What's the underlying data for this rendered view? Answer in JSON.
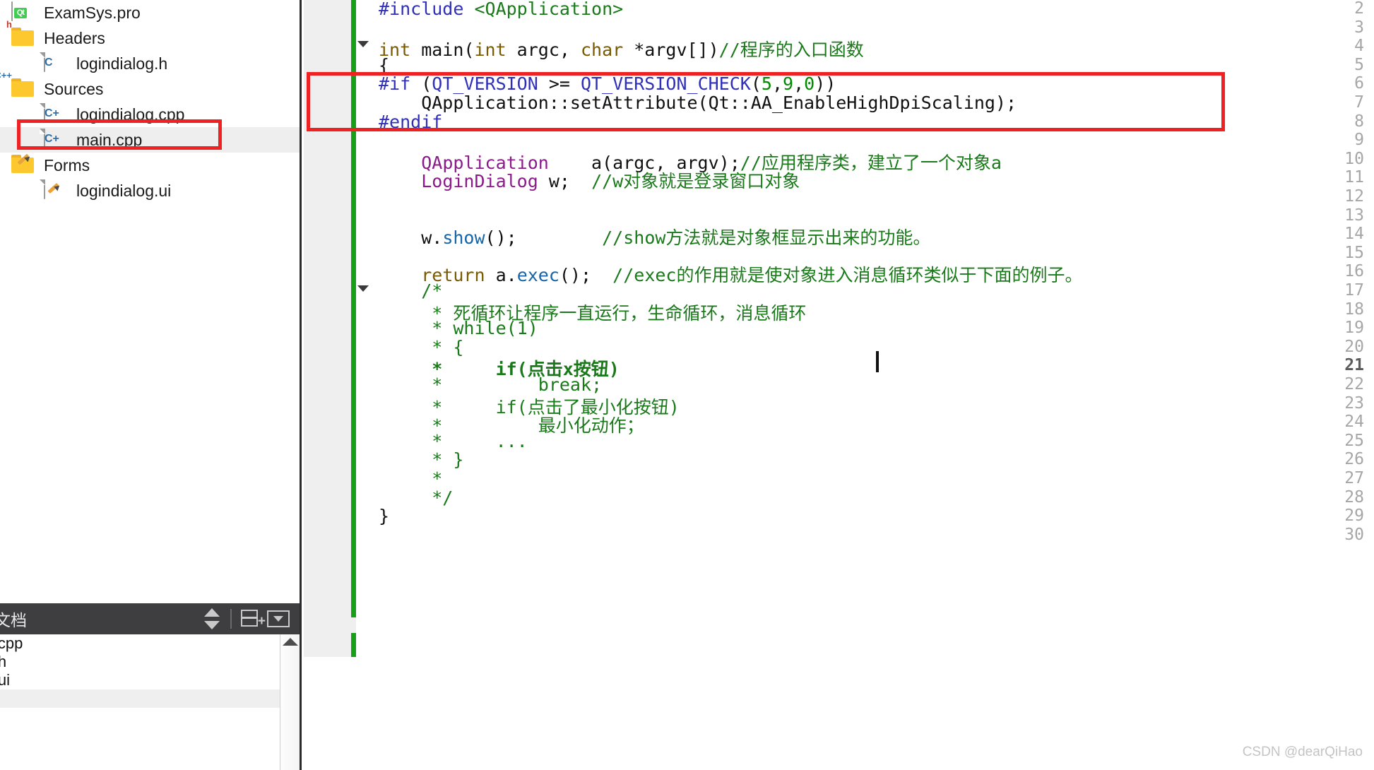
{
  "project_tree": {
    "items": [
      {
        "label": "ExamSys.pro",
        "icon": "qt-project-file-icon",
        "indent": 0,
        "selected": false,
        "kind": "qt"
      },
      {
        "label": "Headers",
        "icon": "folder-headers-icon",
        "indent": 0,
        "selected": false,
        "kind": "folder",
        "badge": "h",
        "badge_color": "#c0392b"
      },
      {
        "label": "logindialog.h",
        "icon": "c-header-file-icon",
        "indent": 1,
        "selected": false,
        "kind": "file",
        "badge": "C",
        "badge_color": "#2e6fa8"
      },
      {
        "label": "Sources",
        "icon": "folder-sources-icon",
        "indent": 0,
        "selected": false,
        "kind": "folder",
        "badge": "C++",
        "badge_color": "#2e6fa8"
      },
      {
        "label": "logindialog.cpp",
        "icon": "cpp-source-file-icon",
        "indent": 1,
        "selected": false,
        "kind": "file",
        "badge": "C+",
        "badge_color": "#2e6fa8"
      },
      {
        "label": "main.cpp",
        "icon": "cpp-source-file-icon",
        "indent": 1,
        "selected": true,
        "kind": "file",
        "badge": "C+",
        "badge_color": "#2e6fa8"
      },
      {
        "label": "Forms",
        "icon": "folder-forms-icon",
        "indent": 0,
        "selected": false,
        "kind": "folder",
        "badge": "",
        "badge_color": "#e8a33d"
      },
      {
        "label": "logindialog.ui",
        "icon": "ui-form-file-icon",
        "indent": 1,
        "selected": false,
        "kind": "ui",
        "badge": "",
        "badge_color": "#e8a33d"
      }
    ]
  },
  "documents_panel": {
    "title": "文档",
    "buttons": [
      {
        "name": "sort-updown-button",
        "label": ""
      },
      {
        "name": "split-add-button",
        "label": ""
      },
      {
        "name": "close-dropdown-button",
        "label": ""
      }
    ],
    "files": [
      {
        "label": "dialog.cpp",
        "selected": false
      },
      {
        "label": "dialog.h",
        "selected": false
      },
      {
        "label": "dialog.ui",
        "selected": false
      },
      {
        "label": "cpp",
        "selected": true
      }
    ]
  },
  "editor": {
    "first_line": 2,
    "last_line": 30,
    "current_line": 21,
    "fold_markers": [
      4,
      17
    ],
    "lines": [
      {
        "n": 2,
        "segments": [
          {
            "t": "#include ",
            "c": "pre"
          },
          {
            "t": "<QApplication>",
            "c": "cmt"
          }
        ]
      },
      {
        "n": 3,
        "segments": []
      },
      {
        "n": 4,
        "segments": [
          {
            "t": "int",
            "c": "kw"
          },
          {
            "t": " main(",
            "c": "plain"
          },
          {
            "t": "int",
            "c": "kw"
          },
          {
            "t": " argc, ",
            "c": "plain"
          },
          {
            "t": "char",
            "c": "kw"
          },
          {
            "t": " *argv[])",
            "c": "plain"
          },
          {
            "t": "//程序的入口函数",
            "c": "cmt"
          }
        ]
      },
      {
        "n": 5,
        "segments": [
          {
            "t": "{",
            "c": "plain"
          }
        ]
      },
      {
        "n": 6,
        "segments": [
          {
            "t": "#if",
            "c": "pre"
          },
          {
            "t": " (",
            "c": "plain"
          },
          {
            "t": "QT_VERSION",
            "c": "pre"
          },
          {
            "t": " >= ",
            "c": "plain"
          },
          {
            "t": "QT_VERSION_CHECK",
            "c": "pre"
          },
          {
            "t": "(",
            "c": "plain"
          },
          {
            "t": "5",
            "c": "num"
          },
          {
            "t": ",",
            "c": "plain"
          },
          {
            "t": "9",
            "c": "num"
          },
          {
            "t": ",",
            "c": "plain"
          },
          {
            "t": "0",
            "c": "num"
          },
          {
            "t": "))",
            "c": "plain"
          }
        ]
      },
      {
        "n": 7,
        "segments": [
          {
            "t": "    QApplication::setAttribute(Qt::AA_EnableHighDpiScaling);",
            "c": "plain"
          }
        ]
      },
      {
        "n": 8,
        "segments": [
          {
            "t": "#endif",
            "c": "pre"
          }
        ]
      },
      {
        "n": 9,
        "segments": []
      },
      {
        "n": 10,
        "segments": [
          {
            "t": "    ",
            "c": "plain"
          },
          {
            "t": "QApplication",
            "c": "type"
          },
          {
            "t": "    a(argc, argv);",
            "c": "plain"
          },
          {
            "t": "//应用程序类，建立了一个对象a",
            "c": "cmt"
          }
        ]
      },
      {
        "n": 11,
        "segments": [
          {
            "t": "    ",
            "c": "plain"
          },
          {
            "t": "LoginDialog",
            "c": "type"
          },
          {
            "t": " w;  ",
            "c": "plain"
          },
          {
            "t": "//w对象就是登录窗口对象",
            "c": "cmt"
          }
        ]
      },
      {
        "n": 12,
        "segments": []
      },
      {
        "n": 13,
        "segments": []
      },
      {
        "n": 14,
        "segments": [
          {
            "t": "    w.",
            "c": "plain"
          },
          {
            "t": "show",
            "c": "fn"
          },
          {
            "t": "();        ",
            "c": "plain"
          },
          {
            "t": "//show方法就是对象框显示出来的功能。",
            "c": "cmt"
          }
        ]
      },
      {
        "n": 15,
        "segments": []
      },
      {
        "n": 16,
        "segments": [
          {
            "t": "    ",
            "c": "plain"
          },
          {
            "t": "return",
            "c": "kw"
          },
          {
            "t": " a.",
            "c": "plain"
          },
          {
            "t": "exec",
            "c": "fn"
          },
          {
            "t": "();  ",
            "c": "plain"
          },
          {
            "t": "//exec的作用就是使对象进入消息循环类似于下面的例子。",
            "c": "cmt"
          }
        ]
      },
      {
        "n": 17,
        "segments": [
          {
            "t": "    /*",
            "c": "cmt"
          }
        ]
      },
      {
        "n": 18,
        "segments": [
          {
            "t": "     * 死循环让程序一直运行，生命循环，消息循环",
            "c": "cmt"
          }
        ]
      },
      {
        "n": 19,
        "segments": [
          {
            "t": "     * while(1)",
            "c": "cmt"
          }
        ]
      },
      {
        "n": 20,
        "segments": [
          {
            "t": "     * {",
            "c": "cmt"
          }
        ]
      },
      {
        "n": 21,
        "segments": [
          {
            "t": "     *     if(点击x按钮)",
            "c": "cmt"
          }
        ]
      },
      {
        "n": 22,
        "segments": [
          {
            "t": "     *         break;",
            "c": "cmt"
          }
        ]
      },
      {
        "n": 23,
        "segments": [
          {
            "t": "     *     if(点击了最小化按钮)",
            "c": "cmt"
          }
        ]
      },
      {
        "n": 24,
        "segments": [
          {
            "t": "     *         最小化动作；",
            "c": "cmt"
          }
        ]
      },
      {
        "n": 25,
        "segments": [
          {
            "t": "     *     ...",
            "c": "cmt"
          }
        ]
      },
      {
        "n": 26,
        "segments": [
          {
            "t": "     * }",
            "c": "cmt"
          }
        ]
      },
      {
        "n": 27,
        "segments": [
          {
            "t": "     *",
            "c": "cmt"
          }
        ]
      },
      {
        "n": 28,
        "segments": [
          {
            "t": "     */",
            "c": "cmt"
          }
        ]
      },
      {
        "n": 29,
        "segments": [
          {
            "t": "}",
            "c": "plain"
          }
        ]
      },
      {
        "n": 30,
        "segments": []
      }
    ]
  },
  "annotations": {
    "main_cpp_box_color": "#ee2222",
    "code_box_color": "#ee2222"
  },
  "watermark": "CSDN @dearQiHao"
}
